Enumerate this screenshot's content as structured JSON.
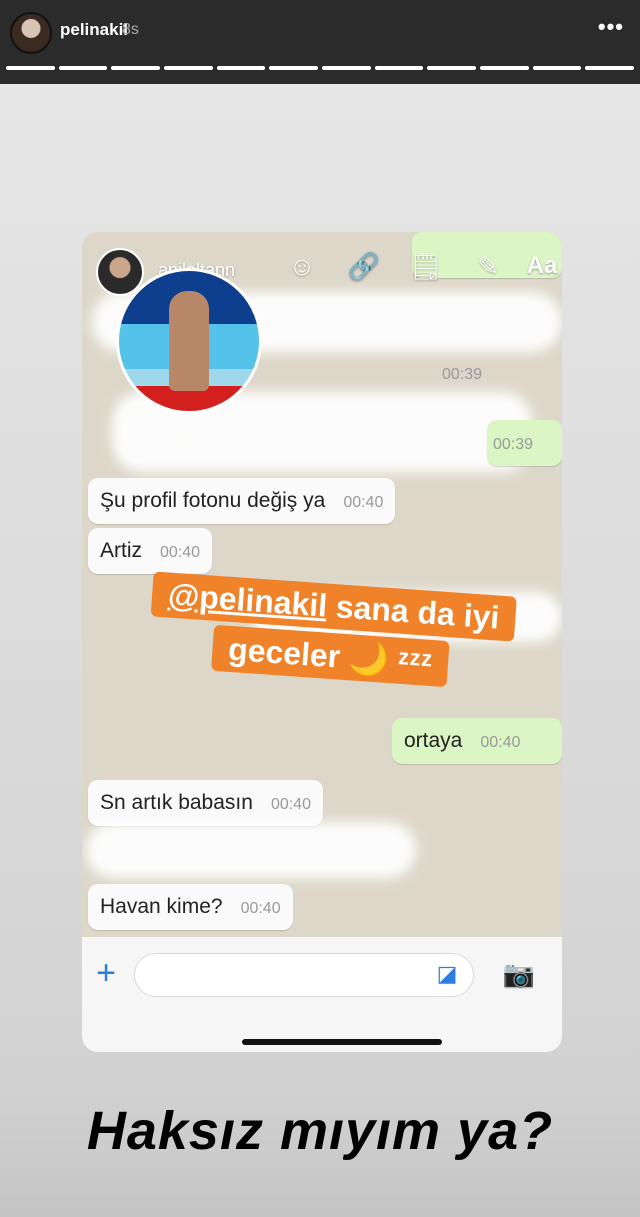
{
  "story": {
    "username": "pelinakil",
    "time": "8s",
    "menu": "•••"
  },
  "overlay": {
    "username": "anilaltann",
    "tools": {
      "emoji": "☺",
      "link": "🔗",
      "sticker": "🗒",
      "pen": "✎",
      "text": "Aa"
    }
  },
  "chat": {
    "blurred_times": [
      "00:39",
      "00:39",
      "00:40"
    ],
    "messages": [
      {
        "text": "Şu profil fotonu değiş ya",
        "time": "00:40"
      },
      {
        "text": "Artiz",
        "time": "00:40"
      },
      {
        "text": "ortaya",
        "time": "00:40"
      },
      {
        "text": "Sn artık babasın",
        "time": "00:40"
      },
      {
        "text": "Havan kime?",
        "time": "00:40"
      }
    ],
    "sticker_line1_mention": "@pelinakil",
    "sticker_line1_rest": "sana da iyi",
    "sticker_line2": "geceler 🌙 ᶻᶻᶻ"
  },
  "input": {
    "plus": "+",
    "sticker_icon": "◪",
    "camera_icon": "📷"
  },
  "caption": "Haksız mıyım ya?"
}
